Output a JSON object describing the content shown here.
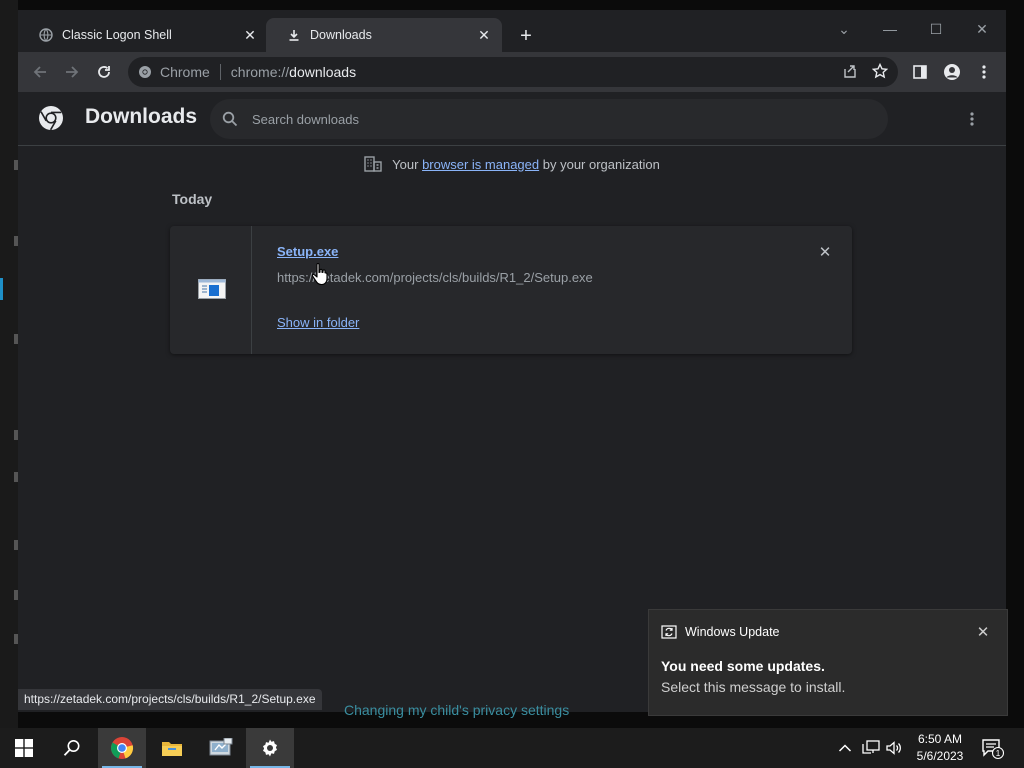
{
  "tabs": [
    {
      "label": "Classic Logon Shell",
      "icon": "globe-icon"
    },
    {
      "label": "Downloads",
      "icon": "download-icon"
    }
  ],
  "toolbar": {
    "site_label": "Chrome",
    "url_prefix": "chrome://",
    "url_host": "downloads"
  },
  "header": {
    "title": "Downloads",
    "search_placeholder": "Search downloads"
  },
  "managed": {
    "prefix": "Your",
    "link": "browser is managed",
    "suffix": "by your organization"
  },
  "section": {
    "label": "Today"
  },
  "download": {
    "file_name": "Setup.exe",
    "url": "https://zetadek.com/projects/cls/builds/R1_2/Setup.exe",
    "action": "Show in folder"
  },
  "statusbar": {
    "url": "https://zetadek.com/projects/cls/builds/R1_2/Setup.exe"
  },
  "background_link": {
    "text": "Changing my child's privacy settings"
  },
  "toast": {
    "app": "Windows Update",
    "title": "You need some updates.",
    "body": "Select this message to install."
  },
  "taskbar": {
    "time": "6:50 AM",
    "date": "5/6/2023",
    "notification_count": "1"
  },
  "colors": {
    "accent_link": "#8ab4f8",
    "window_bg": "#202124",
    "toolbar_bg": "#35363a"
  }
}
